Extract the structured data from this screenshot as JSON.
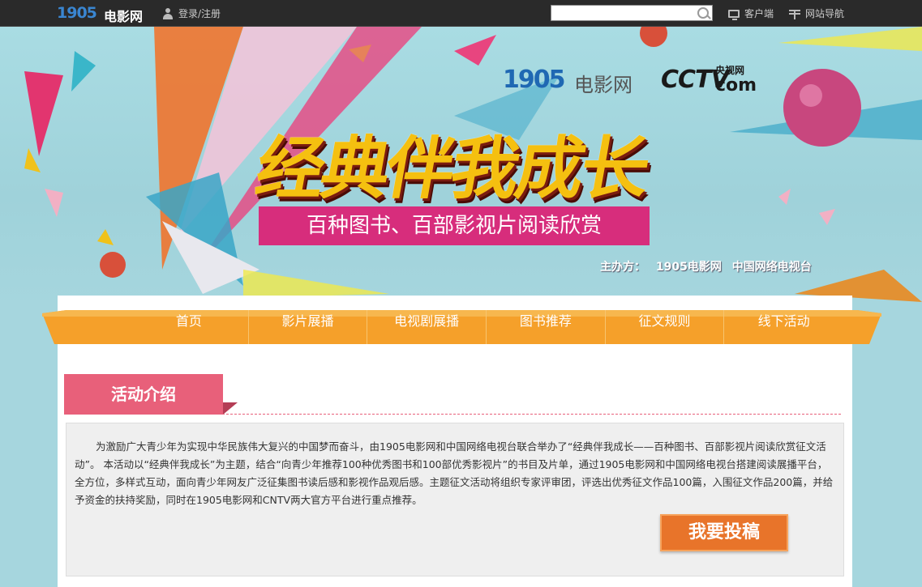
{
  "topbar": {
    "logo_number": "1905",
    "logo_text": "电影网",
    "login_label": "登录/注册",
    "search_placeholder": "",
    "client_label": "客户端",
    "sitenav_label": "网站导航"
  },
  "banner": {
    "logo_1905_number": "1905",
    "logo_1905_text": "电影网",
    "cctv_text": "CCTV",
    "cctv_cn": "央视网",
    "cctv_com": "com",
    "headline": "经典伴我成长",
    "subheadline": "百种图书、百部影视片阅读欣赏",
    "sponsor_label": "主办方：",
    "sponsor_1": "1905电影网",
    "sponsor_2": "中国网络电视台"
  },
  "nav": {
    "items": [
      {
        "label": "首页"
      },
      {
        "label": "影片展播"
      },
      {
        "label": "电视剧展播"
      },
      {
        "label": "图书推荐"
      },
      {
        "label": "征文规则"
      },
      {
        "label": "线下活动"
      }
    ]
  },
  "section": {
    "title": "活动介绍",
    "intro": "为激励广大青少年为实现中华民族伟大复兴的中国梦而奋斗，由1905电影网和中国网络电视台联合举办了“经典伴我成长——百种图书、百部影视片阅读欣赏征文活动”。 本活动以“经典伴我成长”为主题，结合“向青少年推荐100种优秀图书和100部优秀影视片”的书目及片单，通过1905电影网和中国网络电视台搭建阅读展播平台，全方位，多样式互动，面向青少年网友广泛征集图书读后感和影视作品观后感。主题征文活动将组织专家评审团，评选出优秀征文作品100篇，入围征文作品200篇，并给予资金的扶持奖励，同时在1905电影网和CNTV两大官方平台进行重点推荐。",
    "submit_label": "我要投稿"
  },
  "colors": {
    "nav_orange": "#f5a02a",
    "section_pink": "#e8607a",
    "subhead_magenta": "#d72d7c",
    "button_orange": "#e8742a"
  }
}
